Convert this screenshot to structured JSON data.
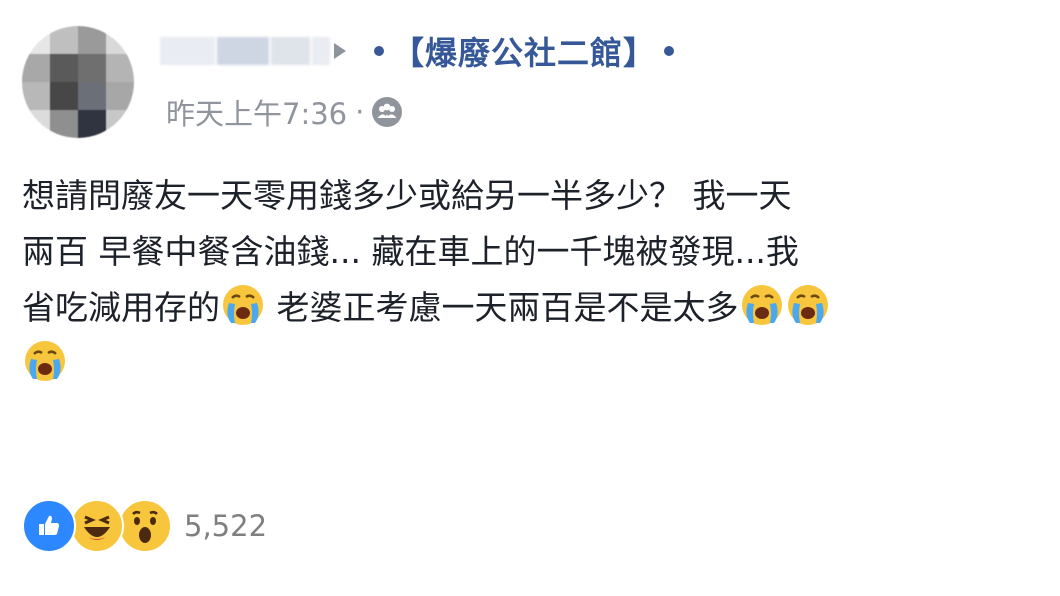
{
  "post": {
    "author": {
      "avatar_icon": "blurred-avatar",
      "name_icon": "blurred-name"
    },
    "group": {
      "name": "【爆廢公社二館】",
      "color": "#365899"
    },
    "meta": {
      "timestamp": "昨天上午7:36",
      "separator": "·",
      "audience_icon": "friends-icon"
    },
    "content": {
      "line1": "想請問廢友一天零用錢多少或給另一半多少？ 我一天",
      "line2": "兩百 早餐中餐含油錢... 藏在車上的一千塊被發現...我",
      "line3_a": "省吃減用存的",
      "line3_b": " 老婆正考慮一天兩百是不是太多",
      "emoji": "crying-face-emoji"
    },
    "reactions": {
      "icons": [
        "like-icon",
        "haha-icon",
        "wow-icon"
      ],
      "count": "5,522"
    }
  }
}
